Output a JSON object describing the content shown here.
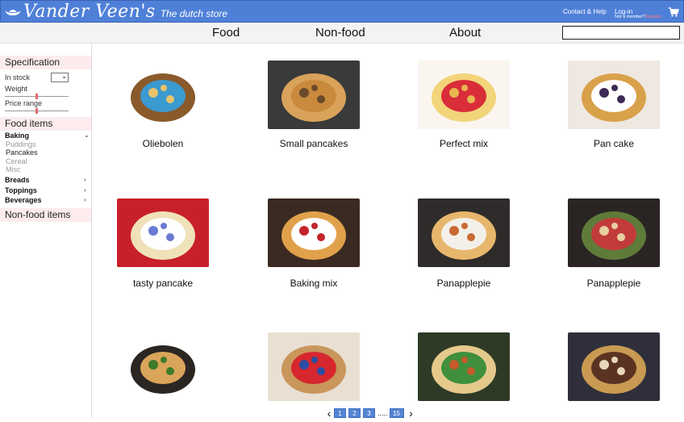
{
  "header": {
    "brand": "Vander Veen's",
    "tagline": "The dutch store",
    "contact": "Contact & Help",
    "login": "Log-in",
    "not_member": "Not a member?",
    "register": "Register"
  },
  "nav": {
    "items": [
      "Food",
      "Non-food",
      "About"
    ],
    "search_value": ""
  },
  "sidebar": {
    "specification": "Specification",
    "in_stock": "In stock",
    "weight": "Weight",
    "price_range": "Price range",
    "weight_level": 0.5,
    "price_level": 0.5,
    "food_items": "Food items",
    "categories": [
      {
        "label": "Baking",
        "open": true,
        "subs": [
          "Puddings",
          "Pancakes",
          "Cereal",
          "Misc"
        ]
      },
      {
        "label": "Breads"
      },
      {
        "label": "Toppings"
      },
      {
        "label": "Beverages"
      }
    ],
    "non_food": "Non-food items"
  },
  "products": [
    {
      "name": "Oliebolen",
      "palette": [
        "#f4f4f4",
        "#8a5a2b",
        "#3b9ad0",
        "#e9c46a"
      ]
    },
    {
      "name": "Small pancakes",
      "palette": [
        "#3a3a3a",
        "#d9a25a",
        "#c98a3e",
        "#6b4a2b"
      ]
    },
    {
      "name": "Perfect mix",
      "palette": [
        "#faf6ef",
        "#f2d47a",
        "#d92d3a",
        "#e9b64f"
      ]
    },
    {
      "name": "Pan cake",
      "palette": [
        "#efe8e0",
        "#d9a14a",
        "#ffffff",
        "#3c2a55"
      ]
    },
    {
      "name": "tasty pancake",
      "palette": [
        "#c8202a",
        "#f0e2b8",
        "#ffffff",
        "#6a7bd1"
      ]
    },
    {
      "name": "Baking mix",
      "palette": [
        "#3a2a22",
        "#e0a14a",
        "#ffffff",
        "#c3242e"
      ]
    },
    {
      "name": "Panapplepie",
      "palette": [
        "#2f2b2a",
        "#e7b66d",
        "#f3f0ea",
        "#c86a33"
      ]
    },
    {
      "name": "Panapplepie",
      "palette": [
        "#2a2523",
        "#5f7b3a",
        "#c23b3b",
        "#e7cfa0"
      ]
    },
    {
      "name": "",
      "palette": [
        "#ffffff",
        "#2b2622",
        "#d9a55a",
        "#3d7a2a"
      ]
    },
    {
      "name": "",
      "palette": [
        "#e9e0d3",
        "#c9965c",
        "#d6272e",
        "#2a4ea3"
      ]
    },
    {
      "name": "",
      "palette": [
        "#2e3a26",
        "#e5c98b",
        "#3f8f3c",
        "#c45b2b"
      ]
    },
    {
      "name": "",
      "palette": [
        "#2e2f3a",
        "#c89a52",
        "#5a3322",
        "#e8d8b9"
      ]
    }
  ],
  "pagination": {
    "pages": [
      "1",
      "2",
      "3"
    ],
    "ellipsis": ".....",
    "last": "15",
    "current": "1"
  },
  "colors": {
    "header_bg": "#4f80d8",
    "nav_bg": "#f3f3f3",
    "section_bg": "#fdeced",
    "page_button": "#5585d4"
  }
}
